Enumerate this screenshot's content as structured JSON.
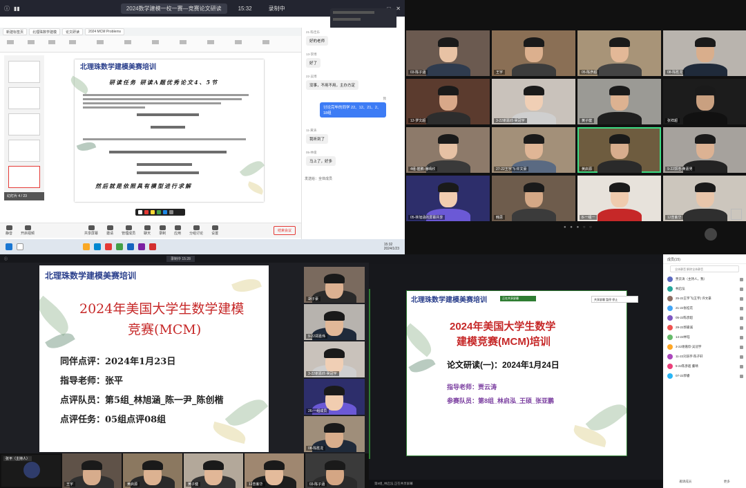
{
  "colors": {
    "title_red": "#c62828",
    "org_blue": "#2a3f8c",
    "purple": "#7b3fa0",
    "speaker_green": "#3ddc84"
  },
  "q1": {
    "meeting_title": "2024数学建模一校一赛—竞赛论文研读",
    "clock": "15:32",
    "recording": "录制中",
    "tabs": [
      "新建标签页",
      "北理珠数学建模",
      "论文研读",
      "2024 MCM Problems"
    ],
    "slide": {
      "org": "北理珠数学建模美赛培训",
      "task_line": "研读任务  研读A题优秀论文4、5节",
      "footer_line": "然后就是依照具有模型进行求解"
    },
    "thumbs_label": "幻灯片 4 / 23",
    "chat": [
      {
        "who": "21-陈佳乐",
        "text": "好的老师",
        "me": false
      },
      {
        "who": "13-李博",
        "text": "好了",
        "me": false
      },
      {
        "who": "22-吴博",
        "text": "没事，不用不用，主办方定",
        "me": false
      },
      {
        "who": "我",
        "text": "讨论完毕的同学 22、12、21、2、18组",
        "me": true
      },
      {
        "who": "11-黄涛",
        "text": "我听到了",
        "me": false
      },
      {
        "who": "05-林俊",
        "text": "马上了，好多",
        "me": false
      }
    ],
    "chat_input": "发送给：全体成员",
    "bottom_buttons": [
      "静音",
      "开启视频",
      "共享屏幕",
      "邀请",
      "管理成员",
      "聊天",
      "录制",
      "应用",
      "分组讨论",
      "设置"
    ],
    "end_button": "结束会议",
    "taskbar_time": "15:32",
    "taskbar_date": "2024/1/23"
  },
  "q2": {
    "tiles": [
      {
        "name": "03-陈子涵",
        "skin": "#e8c2a4",
        "shirt": "#2f3b4e",
        "bg": "#6b5a50"
      },
      {
        "name": "王宇",
        "skin": "#dcb08e",
        "shirt": "#3c3c3c",
        "bg": "#8a6f55"
      },
      {
        "name": "05-陈彦超",
        "skin": "#e3b897",
        "shirt": "#444444",
        "bg": "#a89478"
      },
      {
        "name": "08-陈胜龙",
        "skin": "#d9ae8c",
        "shirt": "#1f2a3a",
        "bg": "#b9b4ae"
      },
      {
        "name": "12-罗文超",
        "skin": "#d8a889",
        "shirt": "#2d2d2d",
        "bg": "#5b3b2e"
      },
      {
        "name": "3-22谢嘉欣-吴冠宇",
        "skin": "#f0cfb5",
        "shirt": "#cfcfcf",
        "bg": "#c9c2bb"
      },
      {
        "name": "黄子健",
        "skin": "#ddb291",
        "shirt": "#1f1f1f",
        "bg": "#9b9a95"
      },
      {
        "name": "张祥超",
        "skin": "#c9a080",
        "shirt": "#111111",
        "bg": "#1c1c1c"
      },
      {
        "name": "4组-崔鹏-潘晴欣",
        "skin": "#e6c1a4",
        "shirt": "#3a3a3a",
        "bg": "#8d7a6a"
      },
      {
        "name": "27-22王宇飞-许文豪",
        "skin": "#e0b696",
        "shirt": "#5a6a82",
        "bg": "#a39079"
      },
      {
        "name": "黄启源",
        "skin": "#d7ad8d",
        "shirt": "#2a2a2a",
        "bg": "#6e5c3f"
      },
      {
        "name": "9-22郭浩-黄嘉男",
        "skin": "#dcb293",
        "shirt": "#232323",
        "bg": "#a6a29d"
      },
      {
        "name": "05-林旭涵的屏幕共享",
        "skin": "#f1cdb0",
        "shirt": "#6b59d6",
        "bg": "#2d2e6b"
      },
      {
        "name": "韩思",
        "skin": "#d4a886",
        "shirt": "#3b3b3b",
        "bg": "#6e5c4c"
      },
      {
        "name": "8-一组一",
        "skin": "#efcbae",
        "shirt": "#c62828",
        "bg": "#e7e2db"
      },
      {
        "name": "12曾紫华",
        "skin": "#e8c6ab",
        "shirt": "#2f2f2f",
        "bg": "#ccc6bd"
      }
    ],
    "speaker_index": 10,
    "page_dots": "● ● ● ○ ○"
  },
  "q3": {
    "recording": "录制中 15:28",
    "slide": {
      "org": "北理珠数学建模美赛培训",
      "title_1": "2024年美国大学生数学建模",
      "title_2": "竞赛(MCM)",
      "line_date": "同伴点评：2024年1月23日",
      "line_teacher": "指导老师：张平",
      "line_team": "点评队员：第5组_林旭涵_陈一尹_陈创楷",
      "line_task": "点评任务：05组点评08组"
    },
    "side_tiles": [
      {
        "name": "胡子豪",
        "skin": "#dcb191",
        "shirt": "#2a2a2a",
        "bg": "#7a6a5e"
      },
      {
        "name": "9-22郑嘉伟",
        "skin": "#e1b898",
        "shirt": "#1f2a3a",
        "bg": "#b7b3ae"
      },
      {
        "name": "3-22谢嘉欣-吴冠宇",
        "skin": "#f0cfb5",
        "shirt": "#cfcfcf",
        "bg": "#c9c2bb"
      },
      {
        "name": "26-一组成员",
        "skin": "#f1cdb0",
        "shirt": "#6b59d6",
        "bg": "#2d2e6b"
      },
      {
        "name": "08-陈胜龙",
        "skin": "#d9ae8c",
        "shirt": "#1f2a3a",
        "bg": "#9f8e7a"
      }
    ],
    "strip_self": "张平（主持人）",
    "strip_tiles": [
      {
        "name": "王宇",
        "skin": "#d7ac8c",
        "shirt": "#2f2f2f",
        "bg": "#5f5248"
      },
      {
        "name": "黄启源",
        "skin": "#dcb291",
        "shirt": "#2a2a2a",
        "bg": "#8b7860"
      },
      {
        "name": "黄子健",
        "skin": "#e1b797",
        "shirt": "#333333",
        "bg": "#b3a89a"
      },
      {
        "name": "12曾紫华",
        "skin": "#e4bb9b",
        "shirt": "#1d1d1d",
        "bg": "#9f8770"
      },
      {
        "name": "03-陈子涵",
        "skin": "#d4a684",
        "shirt": "#2b2b2b",
        "bg": "#3a3a3a"
      }
    ]
  },
  "q4": {
    "slide": {
      "org": "北理珠数学建模美赛培训",
      "title_1": "2024年美国大学生数学",
      "title_2": "建模竞赛(MCM)培训",
      "subtitle": "论文研读(一)：2024年1月24日",
      "teacher": "指导老师：贾云涛",
      "team": "参赛队员：第8组_林启泓_王硕_张亚鹏"
    },
    "share_label": "正在共享屏幕",
    "tiny_bar": "共享屏幕  暂停  停止",
    "sidebar_title": "成员(15)",
    "mute_all": "全体静音  解除全体静音",
    "participants": [
      {
        "name": "贾云涛（主持人，我）",
        "color": "#5c6bc0"
      },
      {
        "name": "林启泓",
        "color": "#26a69a"
      },
      {
        "name": "25-22王宇飞(王宇) 许文豪",
        "color": "#8d6e63"
      },
      {
        "name": "21-22张桂花",
        "color": "#42a5f5"
      },
      {
        "name": "05-22陈彦超",
        "color": "#7e57c2"
      },
      {
        "name": "29-22郭嘉诚",
        "color": "#ef5350"
      },
      {
        "name": "14-22林钰",
        "color": "#66bb6a"
      },
      {
        "name": "3-22谢嘉欣-吴冠宇",
        "color": "#ffa726"
      },
      {
        "name": "11-22刘浩宇-陈子轩",
        "color": "#ab47bc"
      },
      {
        "name": "5-22陈彦超 董晴",
        "color": "#ec407a"
      },
      {
        "name": "07-22郭睿",
        "color": "#29b6f6"
      }
    ],
    "footer": [
      "邀请成员",
      "更多"
    ],
    "bottom_text": "第8组_林启泓 正在共享屏幕"
  }
}
